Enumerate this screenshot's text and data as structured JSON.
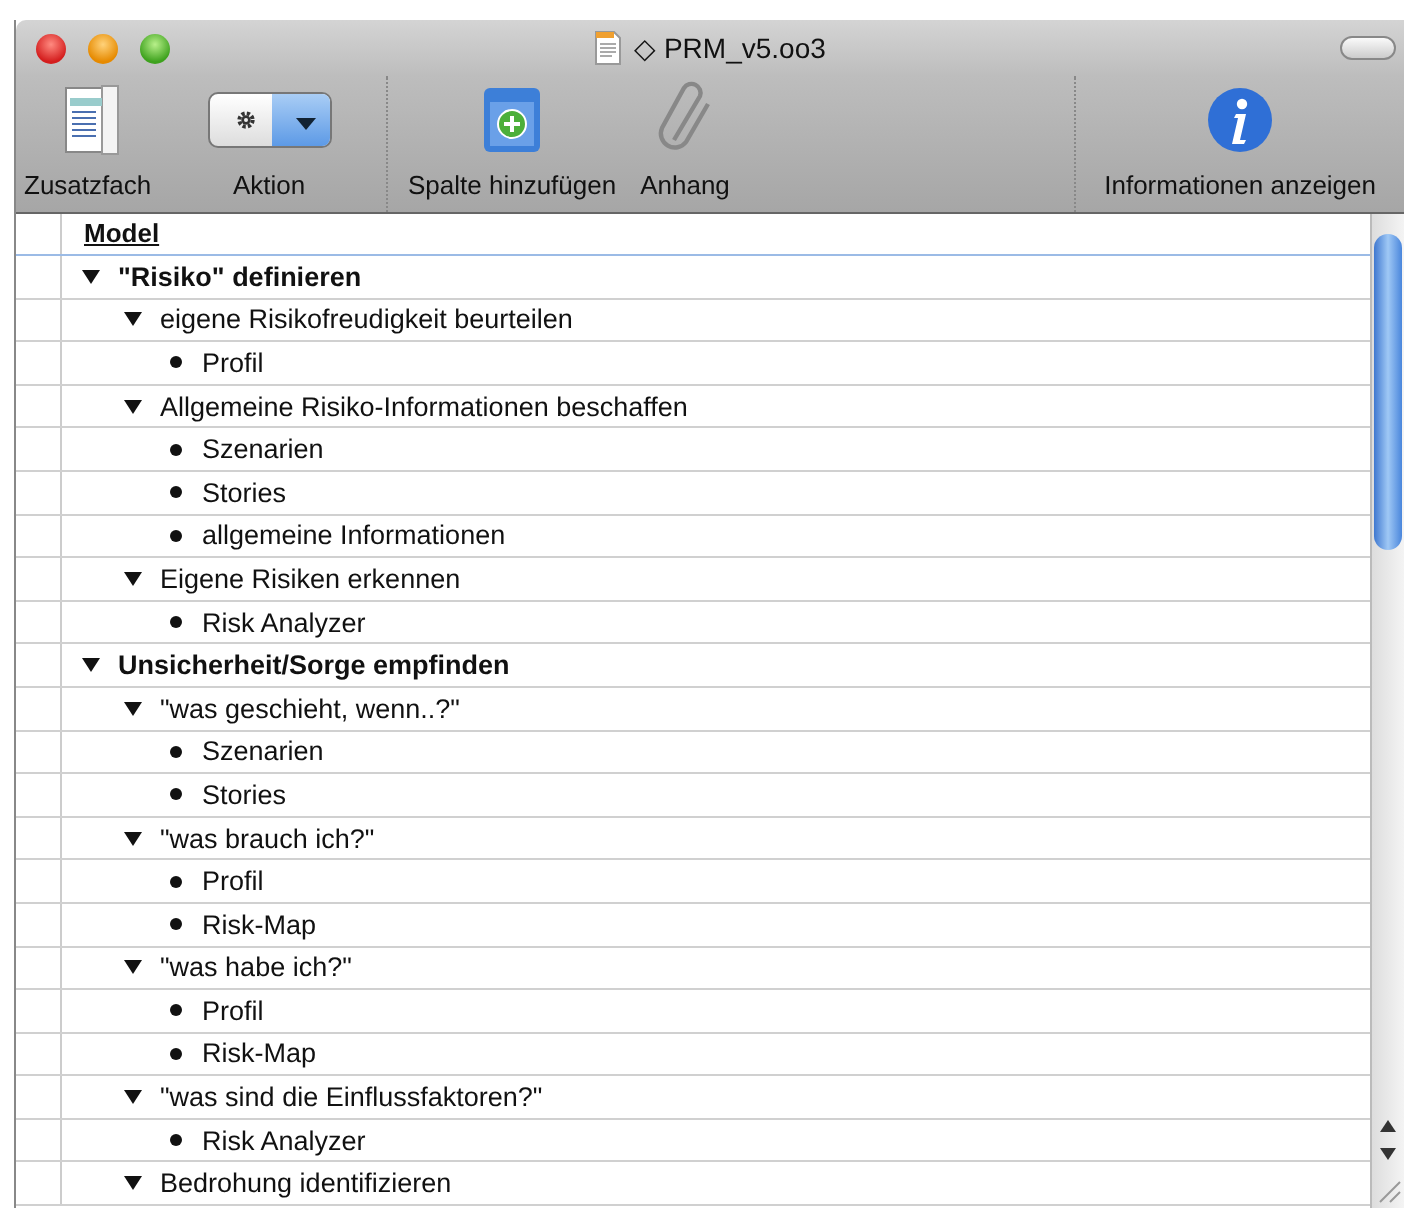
{
  "window": {
    "title": "◇ PRM_v5.oo3"
  },
  "toolbar": {
    "groups": [
      {
        "items": [
          {
            "kind": "drawer",
            "label": "Zusatzfach"
          },
          {
            "kind": "action",
            "label": "Aktion"
          }
        ]
      },
      {
        "items": [
          {
            "kind": "addcolumn",
            "label": "Spalte hinzufügen"
          },
          {
            "kind": "attachment",
            "label": "Anhang"
          }
        ]
      },
      {
        "items": [
          {
            "kind": "info",
            "label": "Informationen anzeigen"
          }
        ]
      }
    ]
  },
  "outline": {
    "column": "Model",
    "items": [
      {
        "text": "\"Risiko\" definieren",
        "expanded": true,
        "children": [
          {
            "text": "eigene Risikofreudigkeit beurteilen",
            "expanded": true,
            "children": [
              {
                "text": "Profil"
              }
            ]
          },
          {
            "text": "Allgemeine Risiko-Informationen beschaffen",
            "expanded": true,
            "children": [
              {
                "text": "Szenarien"
              },
              {
                "text": "Stories"
              },
              {
                "text": "allgemeine Informationen"
              }
            ]
          },
          {
            "text": "Eigene Risiken erkennen",
            "expanded": true,
            "children": [
              {
                "text": "Risk Analyzer"
              }
            ]
          }
        ]
      },
      {
        "text": "Unsicherheit/Sorge empfinden",
        "expanded": true,
        "children": [
          {
            "text": "\"was geschieht, wenn..?\"",
            "expanded": true,
            "children": [
              {
                "text": "Szenarien"
              },
              {
                "text": "Stories"
              }
            ]
          },
          {
            "text": "\"was brauch ich?\"",
            "expanded": true,
            "children": [
              {
                "text": "Profil"
              },
              {
                "text": "Risk-Map"
              }
            ]
          },
          {
            "text": "\"was habe ich?\"",
            "expanded": true,
            "children": [
              {
                "text": "Profil"
              },
              {
                "text": "Risk-Map"
              }
            ]
          },
          {
            "text": "\"was sind die Einflussfaktoren?\"",
            "expanded": true,
            "children": [
              {
                "text": "Risk Analyzer"
              }
            ]
          },
          {
            "text": "Bedrohung identifizieren",
            "expanded": true
          }
        ]
      }
    ]
  }
}
